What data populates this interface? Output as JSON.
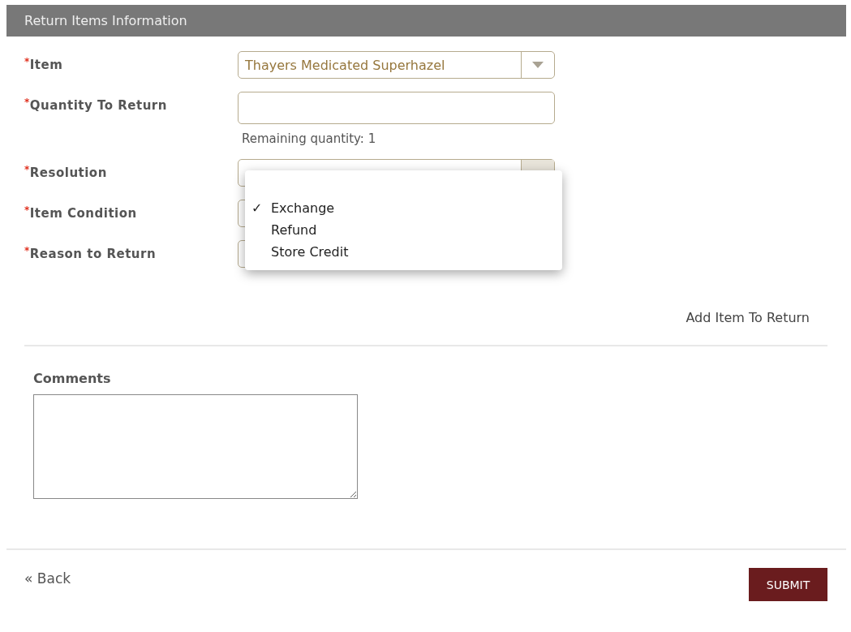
{
  "section": {
    "title": "Return Items Information"
  },
  "fields": [
    {
      "kind": "select",
      "marker": "*",
      "label": "Item",
      "value": "Thayers Medicated Superhazel",
      "caret": true
    },
    {
      "kind": "input",
      "marker": "*",
      "label": "Quantity To Return",
      "hint": "Remaining quantity: 1"
    },
    {
      "kind": "select",
      "marker": "*",
      "label": "Resolution",
      "open": true
    },
    {
      "kind": "select",
      "marker": "*",
      "label": "Item Condition"
    },
    {
      "kind": "select",
      "marker": "*",
      "label": "Reason to Return"
    }
  ],
  "dropdown": {
    "check": "✓",
    "options": [
      {
        "label": "Exchange",
        "selected": true
      },
      {
        "label": "Refund",
        "selected": false
      },
      {
        "label": "Store Credit",
        "selected": false
      }
    ]
  },
  "add_link": "Add Item To Return",
  "comments": {
    "label": "Comments"
  },
  "footer": {
    "back": "« Back",
    "submit": "SUBMIT"
  }
}
